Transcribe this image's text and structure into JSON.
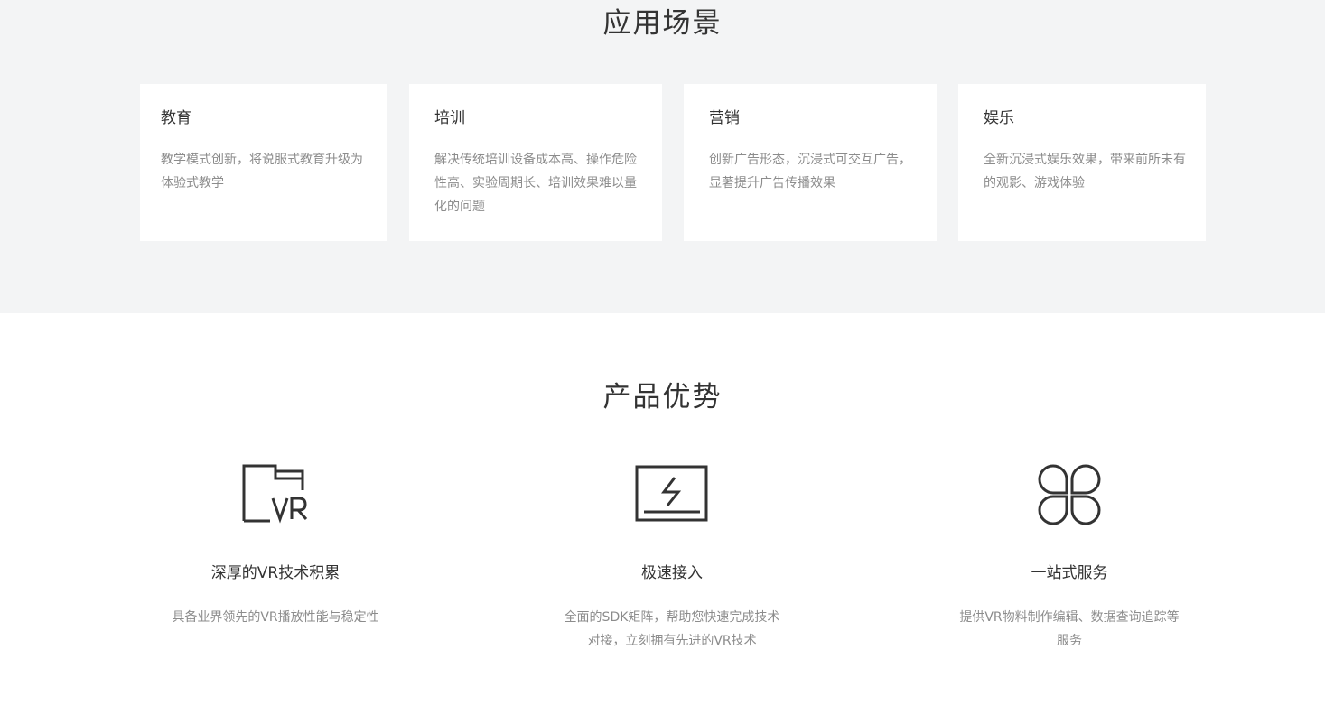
{
  "scenarios": {
    "title": "应用场景",
    "cards": [
      {
        "title": "教育",
        "desc": "教学模式创新，将说服式教育升级为体验式教学"
      },
      {
        "title": "培训",
        "desc": "解决传统培训设备成本高、操作危险性高、实验周期长、培训效果难以量化的问题"
      },
      {
        "title": "营销",
        "desc": "创新广告形态，沉浸式可交互广告，显著提升广告传播效果"
      },
      {
        "title": "娱乐",
        "desc": "全新沉浸式娱乐效果，带来前所未有的观影、游戏体验"
      }
    ]
  },
  "advantages": {
    "title": "产品优势",
    "items": [
      {
        "icon": "vr-folder-icon",
        "title": "深厚的VR技术积累",
        "desc": "具备业界领先的VR播放性能与稳定性"
      },
      {
        "icon": "lightning-screen-icon",
        "title": "极速接入",
        "desc": "全面的SDK矩阵，帮助您快速完成技术对接，立刻拥有先进的VR技术"
      },
      {
        "icon": "four-leaf-icon",
        "title": "一站式服务",
        "desc": "提供VR物料制作编辑、数据查询追踪等服务"
      }
    ]
  },
  "colors": {
    "section_bg": "#f3f4f5",
    "card_bg": "#ffffff",
    "title_text": "#333333",
    "desc_text": "#8c8c8c"
  }
}
